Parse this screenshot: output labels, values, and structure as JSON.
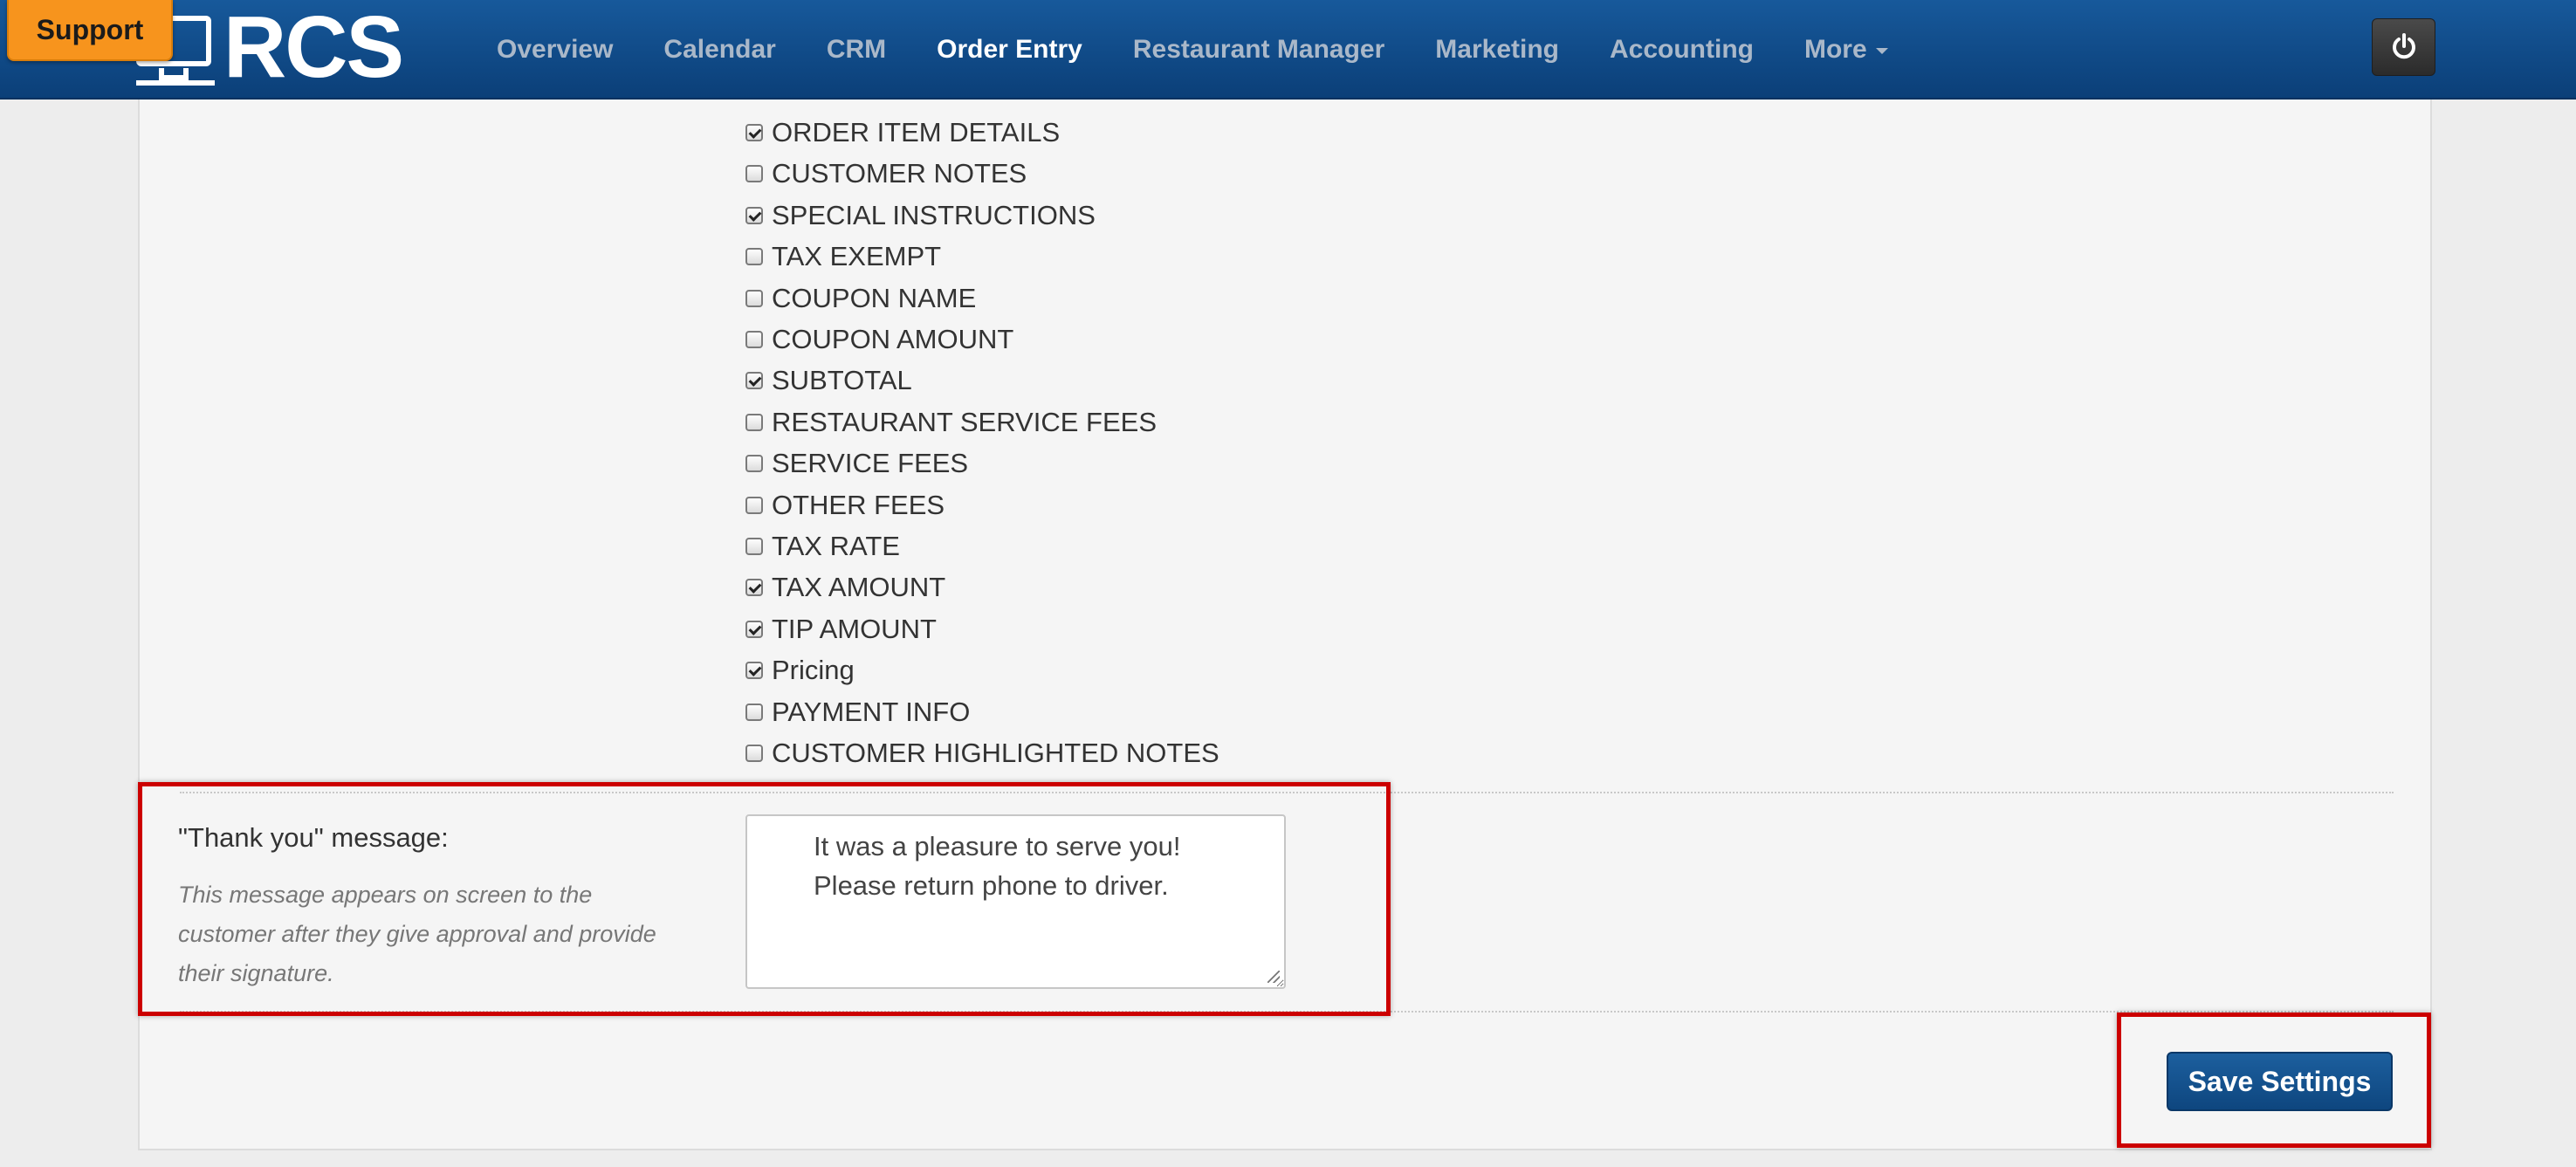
{
  "app": {
    "logo_text": "RCS",
    "support_label": "Support"
  },
  "nav": {
    "items": [
      {
        "label": "Overview"
      },
      {
        "label": "Calendar"
      },
      {
        "label": "CRM"
      },
      {
        "label": "Order Entry",
        "active": true
      },
      {
        "label": "Restaurant Manager"
      },
      {
        "label": "Marketing"
      },
      {
        "label": "Accounting"
      },
      {
        "label": "More",
        "dropdown": true
      }
    ],
    "power_icon": "power-icon"
  },
  "options": [
    {
      "label": "ORDER ITEM DETAILS",
      "checked": true
    },
    {
      "label": "CUSTOMER NOTES",
      "checked": false
    },
    {
      "label": "SPECIAL INSTRUCTIONS",
      "checked": true
    },
    {
      "label": "TAX EXEMPT",
      "checked": false
    },
    {
      "label": "COUPON NAME",
      "checked": false
    },
    {
      "label": "COUPON AMOUNT",
      "checked": false
    },
    {
      "label": "SUBTOTAL",
      "checked": true
    },
    {
      "label": "RESTAURANT SERVICE FEES",
      "checked": false
    },
    {
      "label": "SERVICE FEES",
      "checked": false
    },
    {
      "label": "OTHER FEES",
      "checked": false
    },
    {
      "label": "TAX RATE",
      "checked": false
    },
    {
      "label": "TAX AMOUNT",
      "checked": true
    },
    {
      "label": "TIP AMOUNT",
      "checked": true
    },
    {
      "label": "Pricing",
      "checked": true
    },
    {
      "label": "PAYMENT INFO",
      "checked": false
    },
    {
      "label": "CUSTOMER HIGHLIGHTED NOTES",
      "checked": false
    }
  ],
  "thank_you": {
    "label": "\"Thank you\" message:",
    "help": "This message appears on screen to the customer after they give approval and provide their signature.",
    "value": "It was a pleasure to serve you!\nPlease return phone to driver."
  },
  "save_label": "Save Settings",
  "colors": {
    "nav_bg": "#0b3f78",
    "support_bg": "#f7941d",
    "highlight": "#cc0000",
    "primary_button": "#0e467f"
  }
}
